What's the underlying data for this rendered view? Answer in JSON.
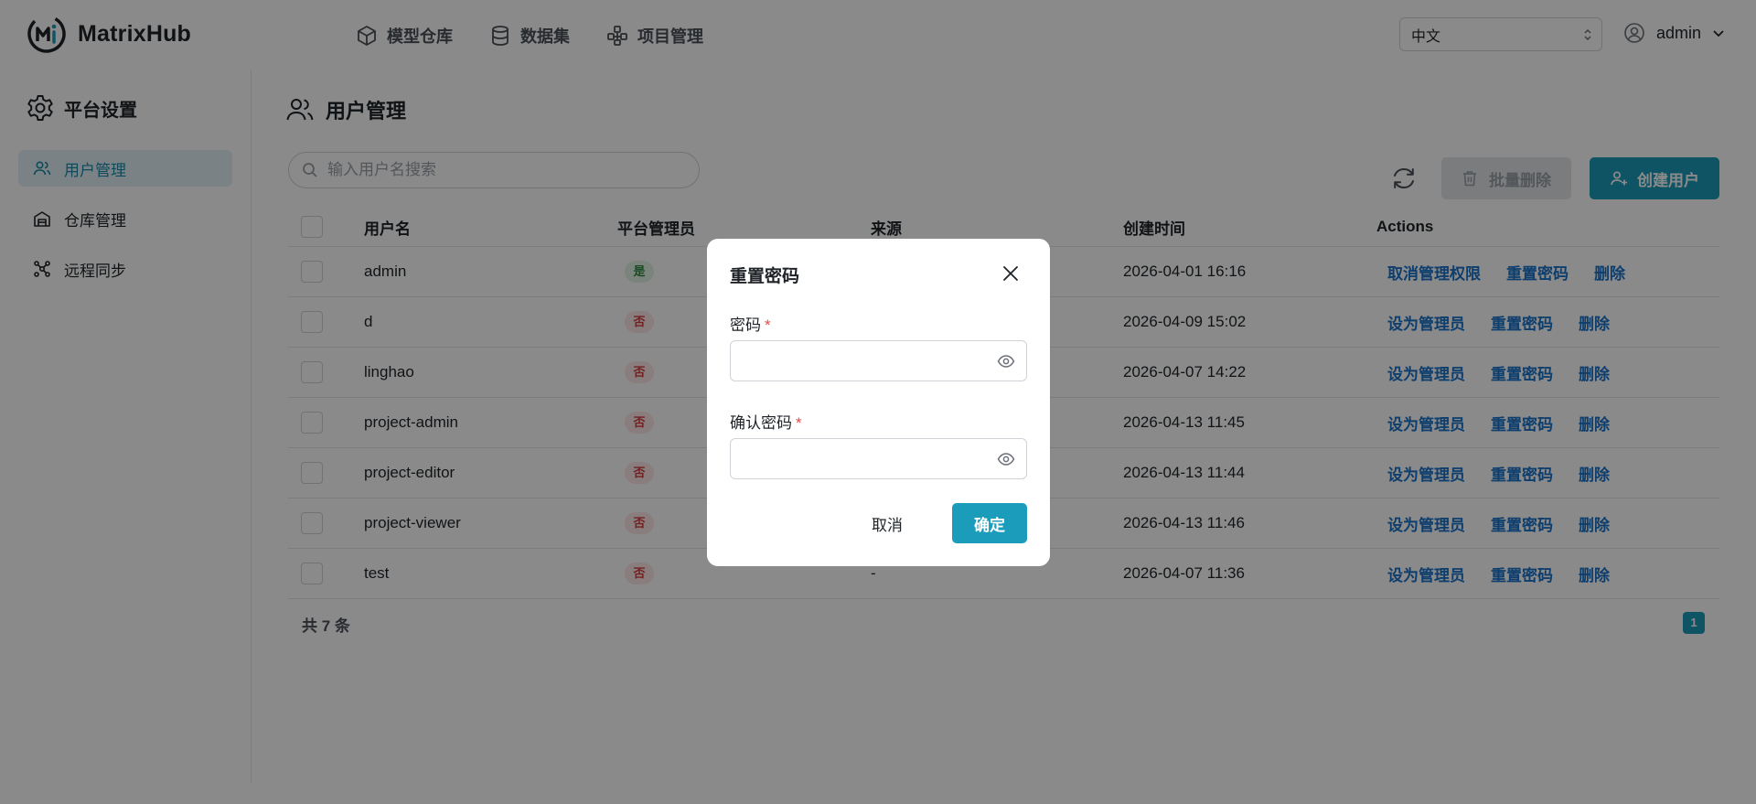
{
  "app": {
    "name": "MatrixHub"
  },
  "topnav": [
    {
      "label": "模型仓库",
      "icon": "cube-icon"
    },
    {
      "label": "数据集",
      "icon": "database-icon"
    },
    {
      "label": "项目管理",
      "icon": "project-icon"
    }
  ],
  "language": {
    "selected": "中文"
  },
  "user": {
    "name": "admin"
  },
  "sidebar": {
    "title": "平台设置",
    "items": [
      {
        "label": "用户管理",
        "icon": "users-icon",
        "active": true
      },
      {
        "label": "仓库管理",
        "icon": "warehouse-icon",
        "active": false
      },
      {
        "label": "远程同步",
        "icon": "sync-nodes-icon",
        "active": false
      }
    ]
  },
  "page": {
    "title": "用户管理",
    "search_placeholder": "输入用户名搜索",
    "bulk_delete_label": "批量删除",
    "create_user_label": "创建用户",
    "total_label": "共 7 条",
    "current_page": "1"
  },
  "table": {
    "columns": [
      "用户名",
      "平台管理员",
      "来源",
      "创建时间",
      "Actions"
    ],
    "rows": [
      {
        "username": "admin",
        "admin": "是",
        "source": "",
        "created": "2026-04-01 16:16",
        "actions": [
          "取消管理权限",
          "重置密码",
          "删除"
        ]
      },
      {
        "username": "d",
        "admin": "否",
        "source": "",
        "created": "2026-04-09 15:02",
        "actions": [
          "设为管理员",
          "重置密码",
          "删除"
        ]
      },
      {
        "username": "linghao",
        "admin": "否",
        "source": "",
        "created": "2026-04-07 14:22",
        "actions": [
          "设为管理员",
          "重置密码",
          "删除"
        ]
      },
      {
        "username": "project-admin",
        "admin": "否",
        "source": "",
        "created": "2026-04-13 11:45",
        "actions": [
          "设为管理员",
          "重置密码",
          "删除"
        ]
      },
      {
        "username": "project-editor",
        "admin": "否",
        "source": "",
        "created": "2026-04-13 11:44",
        "actions": [
          "设为管理员",
          "重置密码",
          "删除"
        ]
      },
      {
        "username": "project-viewer",
        "admin": "否",
        "source": "",
        "created": "2026-04-13 11:46",
        "actions": [
          "设为管理员",
          "重置密码",
          "删除"
        ]
      },
      {
        "username": "test",
        "admin": "否",
        "source": "-",
        "created": "2026-04-07 11:36",
        "actions": [
          "设为管理员",
          "重置密码",
          "删除"
        ]
      }
    ]
  },
  "modal": {
    "title": "重置密码",
    "password_label": "密码",
    "confirm_label": "确认密码",
    "required_mark": "*",
    "cancel_label": "取消",
    "ok_label": "确定"
  },
  "colors": {
    "accent": "#1a9cba",
    "link": "#1a73c9",
    "active_bg": "#e4f1f6",
    "badge_yes": "#2f8a44",
    "badge_no": "#d33b3b"
  }
}
